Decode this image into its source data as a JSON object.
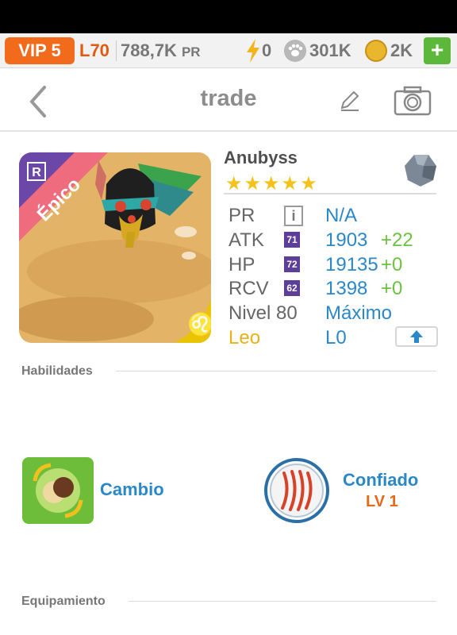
{
  "topbar": {
    "vip": "VIP 5",
    "level": "L70",
    "power": "788,7K",
    "power_unit": "PR",
    "energy": "0",
    "food": "301K",
    "gold": "2K",
    "add_label": "+"
  },
  "nav": {
    "title": "trade"
  },
  "monster": {
    "rarity": "Épico",
    "name": "Anubyss",
    "stars": "★★★★★",
    "star_count": 5,
    "zodiac_symbol": "♌"
  },
  "stats": [
    {
      "label": "PR",
      "value": "N/A"
    },
    {
      "label": "ATK",
      "badge": "71",
      "value": "1903",
      "bonus": "+22"
    },
    {
      "label": "HP",
      "badge": "72",
      "value": "19135",
      "bonus": "+0"
    },
    {
      "label": "RCV",
      "badge": "62",
      "value": "1398",
      "bonus": "+0"
    },
    {
      "label": "Nivel 80",
      "value": "Máximo"
    },
    {
      "label": "Leo",
      "value": "L0"
    }
  ],
  "info_glyph": "i",
  "sections": {
    "skills": "Habilidades",
    "equipment": "Equipamiento"
  },
  "skills": {
    "active_name": "Cambio",
    "passive_name": "Confiado",
    "passive_level": "LV 1"
  },
  "colors": {
    "accent_blue": "#2a88c9",
    "bonus_green": "#6cc23e",
    "vip_orange": "#f26b1d",
    "rarity_pink": "#ef6b7e",
    "zodiac_gold": "#e8b216",
    "stat_badge_purple": "#5d3e9a"
  },
  "icons": [
    "back-arrow-icon",
    "edit-pencil-icon",
    "camera-icon",
    "lightning-icon",
    "paw-icon",
    "coin-icon",
    "rune-gem-icon",
    "upgrade-arrow-icon",
    "swap-skill-icon",
    "claw-passive-icon"
  ]
}
